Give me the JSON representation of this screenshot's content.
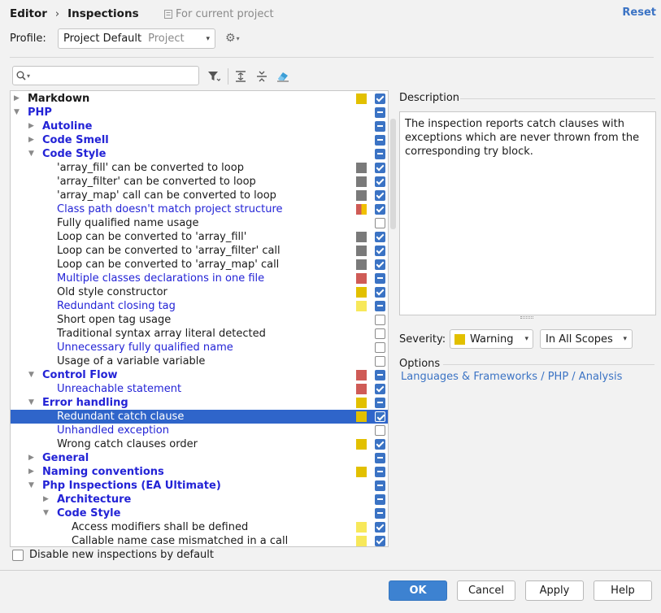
{
  "header": {
    "breadcrumb_parent": "Editor",
    "breadcrumb_sep": "›",
    "breadcrumb_current": "Inspections",
    "scope_note": "For current project",
    "reset_label": "Reset"
  },
  "profile": {
    "label": "Profile:",
    "value": "Project Default",
    "value_suffix": "Project"
  },
  "search": {
    "value": "",
    "placeholder": ""
  },
  "tree": {
    "rows": [
      {
        "label": "Markdown",
        "depth": 0,
        "expand": "collapsed",
        "group": true,
        "blue": false,
        "swatch": "#e2c000",
        "check": "on"
      },
      {
        "label": "PHP",
        "depth": 0,
        "expand": "expanded",
        "group": true,
        "blue": true,
        "swatch": null,
        "check": "part"
      },
      {
        "label": "Autoline",
        "depth": 1,
        "expand": "collapsed",
        "group": true,
        "blue": true,
        "swatch": null,
        "check": "part"
      },
      {
        "label": "Code Smell",
        "depth": 1,
        "expand": "collapsed",
        "group": true,
        "blue": true,
        "swatch": null,
        "check": "part"
      },
      {
        "label": "Code Style",
        "depth": 1,
        "expand": "expanded",
        "group": true,
        "blue": true,
        "swatch": null,
        "check": "part"
      },
      {
        "label": "'array_fill' can be converted to loop",
        "depth": 2,
        "expand": null,
        "group": false,
        "blue": false,
        "swatch": "#7a7a7a",
        "check": "on"
      },
      {
        "label": "'array_filter' can be converted to loop",
        "depth": 2,
        "expand": null,
        "group": false,
        "blue": false,
        "swatch": "#7a7a7a",
        "check": "on"
      },
      {
        "label": "'array_map' call can be converted to loop",
        "depth": 2,
        "expand": null,
        "group": false,
        "blue": false,
        "swatch": "#7a7a7a",
        "check": "on"
      },
      {
        "label": "Class path doesn't match project structure",
        "depth": 2,
        "expand": null,
        "group": false,
        "blue": true,
        "swatch": "split",
        "check": "on"
      },
      {
        "label": "Fully qualified name usage",
        "depth": 2,
        "expand": null,
        "group": false,
        "blue": false,
        "swatch": null,
        "check": "off"
      },
      {
        "label": "Loop can be converted to 'array_fill'",
        "depth": 2,
        "expand": null,
        "group": false,
        "blue": false,
        "swatch": "#7a7a7a",
        "check": "on"
      },
      {
        "label": "Loop can be converted to 'array_filter' call",
        "depth": 2,
        "expand": null,
        "group": false,
        "blue": false,
        "swatch": "#7a7a7a",
        "check": "on"
      },
      {
        "label": "Loop can be converted to 'array_map' call",
        "depth": 2,
        "expand": null,
        "group": false,
        "blue": false,
        "swatch": "#7a7a7a",
        "check": "on"
      },
      {
        "label": "Multiple classes declarations in one file",
        "depth": 2,
        "expand": null,
        "group": false,
        "blue": true,
        "swatch": "#cf5b56",
        "check": "part"
      },
      {
        "label": "Old style constructor",
        "depth": 2,
        "expand": null,
        "group": false,
        "blue": false,
        "swatch": "#e2c000",
        "check": "on"
      },
      {
        "label": "Redundant closing tag",
        "depth": 2,
        "expand": null,
        "group": false,
        "blue": true,
        "swatch": "#f7e85a",
        "check": "part"
      },
      {
        "label": "Short open tag usage",
        "depth": 2,
        "expand": null,
        "group": false,
        "blue": false,
        "swatch": null,
        "check": "off"
      },
      {
        "label": "Traditional syntax array literal detected",
        "depth": 2,
        "expand": null,
        "group": false,
        "blue": false,
        "swatch": null,
        "check": "off"
      },
      {
        "label": "Unnecessary fully qualified name",
        "depth": 2,
        "expand": null,
        "group": false,
        "blue": true,
        "swatch": null,
        "check": "off"
      },
      {
        "label": "Usage of a variable variable",
        "depth": 2,
        "expand": null,
        "group": false,
        "blue": false,
        "swatch": null,
        "check": "off"
      },
      {
        "label": "Control Flow",
        "depth": 1,
        "expand": "expanded",
        "group": true,
        "blue": true,
        "swatch": "#cf5b56",
        "check": "part"
      },
      {
        "label": "Unreachable statement",
        "depth": 2,
        "expand": null,
        "group": false,
        "blue": true,
        "swatch": "#cf5b56",
        "check": "on"
      },
      {
        "label": "Error handling",
        "depth": 1,
        "expand": "expanded",
        "group": true,
        "blue": true,
        "swatch": "#e2c000",
        "check": "part"
      },
      {
        "label": "Redundant catch clause",
        "depth": 2,
        "expand": null,
        "group": false,
        "blue": true,
        "swatch": "#e2c000",
        "check": "on",
        "selected": true
      },
      {
        "label": "Unhandled exception",
        "depth": 2,
        "expand": null,
        "group": false,
        "blue": true,
        "swatch": null,
        "check": "off"
      },
      {
        "label": "Wrong catch clauses order",
        "depth": 2,
        "expand": null,
        "group": false,
        "blue": false,
        "swatch": "#e2c000",
        "check": "on"
      },
      {
        "label": "General",
        "depth": 1,
        "expand": "collapsed",
        "group": true,
        "blue": true,
        "swatch": null,
        "check": "part"
      },
      {
        "label": "Naming conventions",
        "depth": 1,
        "expand": "collapsed",
        "group": true,
        "blue": true,
        "swatch": "#e2c000",
        "check": "part"
      },
      {
        "label": "Php Inspections (EA Ultimate)",
        "depth": 1,
        "expand": "expanded",
        "group": true,
        "blue": true,
        "swatch": null,
        "check": "part"
      },
      {
        "label": "Architecture",
        "depth": 2,
        "expand": "collapsed",
        "group": true,
        "blue": true,
        "swatch": null,
        "check": "part"
      },
      {
        "label": "Code Style",
        "depth": 2,
        "expand": "expanded",
        "group": true,
        "blue": true,
        "swatch": null,
        "check": "part"
      },
      {
        "label": "Access modifiers shall be defined",
        "depth": 3,
        "expand": null,
        "group": false,
        "blue": false,
        "swatch": "#f7e85a",
        "check": "on"
      },
      {
        "label": "Callable name case mismatched in a call",
        "depth": 3,
        "expand": null,
        "group": false,
        "blue": false,
        "swatch": "#f7e85a",
        "check": "on"
      }
    ]
  },
  "description": {
    "label": "Description",
    "text": "The inspection reports catch clauses with exceptions which are never thrown from the corresponding try block."
  },
  "severity": {
    "label": "Severity:",
    "value": "Warning",
    "color": "#e2c000",
    "scope": "In All Scopes"
  },
  "options": {
    "label": "Options",
    "link": "Languages & Frameworks / PHP / Analysis"
  },
  "footer": {
    "disable_label": "Disable new inspections by default",
    "ok": "OK",
    "cancel": "Cancel",
    "apply": "Apply",
    "help": "Help"
  },
  "icons": {
    "gear": "⚙",
    "dropdown": "▾",
    "search": "⚲",
    "filter": "filter-icon",
    "expand_all": "expand-all-icon",
    "collapse_all": "collapse-all-icon",
    "eraser": "eraser-icon"
  }
}
